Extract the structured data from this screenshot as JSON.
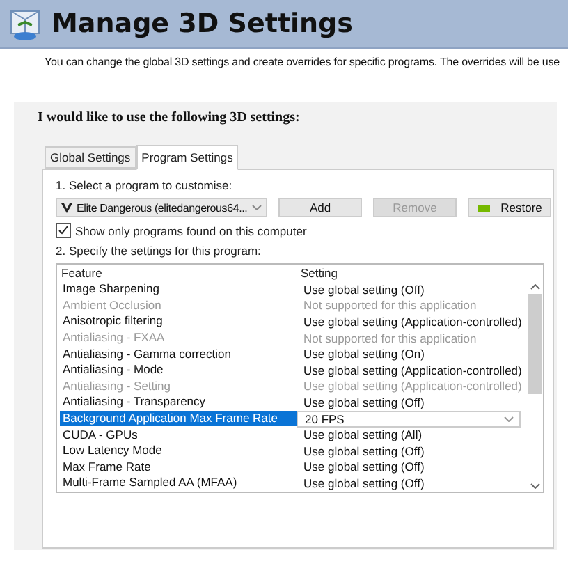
{
  "header": {
    "title": "Manage 3D Settings"
  },
  "description": "You can change the global 3D settings and create overrides for specific programs. The overrides will be use",
  "panel": {
    "heading": "I would like to use the following 3D settings:"
  },
  "tabs": [
    {
      "label": "Global Settings",
      "selected": false
    },
    {
      "label": "Program Settings",
      "selected": true
    }
  ],
  "step1": "1. Select a program to customise:",
  "program_select": {
    "value": "Elite Dangerous (elitedangerous64..."
  },
  "buttons": [
    {
      "label": "Add",
      "disabled": false,
      "kind": "plain"
    },
    {
      "label": "Remove",
      "disabled": true,
      "kind": "plain"
    },
    {
      "label": "Restore",
      "disabled": false,
      "kind": "logo"
    }
  ],
  "show_only_checkbox": {
    "label": "Show only programs found on this computer",
    "checked": true
  },
  "step2": "2. Specify the settings for this program:",
  "table": {
    "columns": [
      "Feature",
      "Setting"
    ],
    "rows": [
      {
        "feature": "Image Sharpening",
        "setting": "Use global setting (Off)",
        "disabled": false,
        "selected": false
      },
      {
        "feature": "Ambient Occlusion",
        "setting": "Not supported for this application",
        "disabled": true,
        "selected": false
      },
      {
        "feature": "Anisotropic filtering",
        "setting": "Use global setting (Application-controlled)",
        "disabled": false,
        "selected": false
      },
      {
        "feature": "Antialiasing - FXAA",
        "setting": "Not supported for this application",
        "disabled": true,
        "selected": false
      },
      {
        "feature": "Antialiasing - Gamma correction",
        "setting": "Use global setting (On)",
        "disabled": false,
        "selected": false
      },
      {
        "feature": "Antialiasing - Mode",
        "setting": "Use global setting (Application-controlled)",
        "disabled": false,
        "selected": false
      },
      {
        "feature": "Antialiasing - Setting",
        "setting": "Use global setting (Application-controlled)",
        "disabled": true,
        "selected": false
      },
      {
        "feature": "Antialiasing - Transparency",
        "setting": "Use global setting (Off)",
        "disabled": false,
        "selected": false
      },
      {
        "feature": "Background Application Max Frame Rate",
        "setting": "20 FPS",
        "disabled": false,
        "selected": true
      },
      {
        "feature": "CUDA - GPUs",
        "setting": "Use global setting (All)",
        "disabled": false,
        "selected": false
      },
      {
        "feature": "Low Latency Mode",
        "setting": "Use global setting (Off)",
        "disabled": false,
        "selected": false
      },
      {
        "feature": "Max Frame Rate",
        "setting": "Use global setting (Off)",
        "disabled": false,
        "selected": false
      },
      {
        "feature": "Multi-Frame Sampled AA (MFAA)",
        "setting": "Use global setting (Off)",
        "disabled": false,
        "selected": false
      }
    ]
  }
}
